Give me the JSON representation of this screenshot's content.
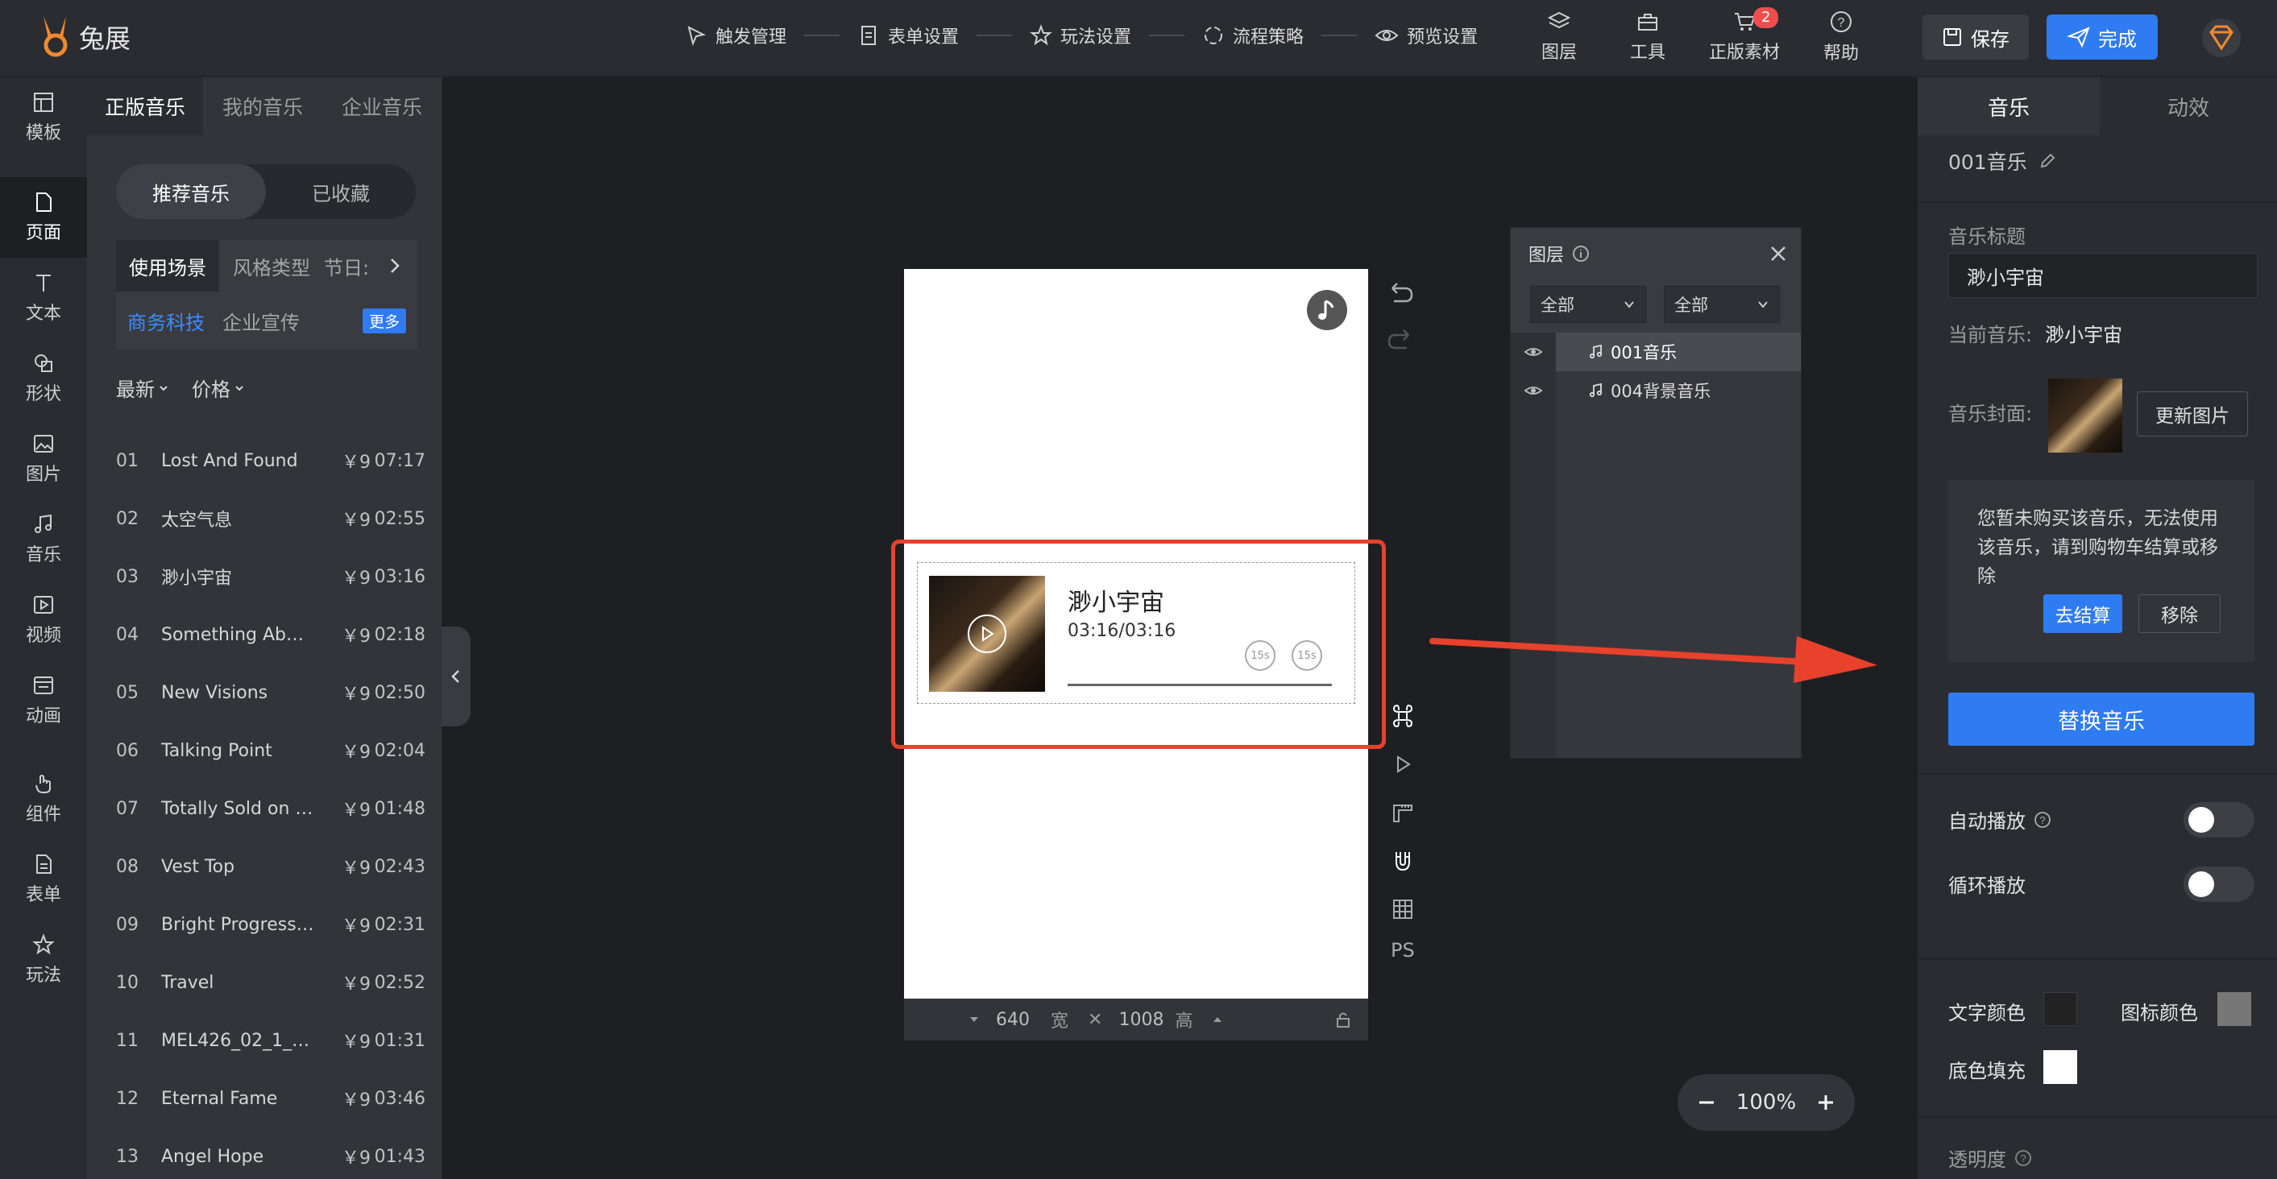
{
  "app": {
    "name": "兔展"
  },
  "toolbar": {
    "steps": [
      "触发管理",
      "表单设置",
      "玩法设置",
      "流程策略",
      "预览设置"
    ],
    "tools": [
      "图层",
      "工具",
      "正版素材",
      "帮助"
    ],
    "cart_badge": "2",
    "save_label": "保存",
    "done_label": "完成"
  },
  "sidebar": {
    "items": [
      "模板",
      "页面",
      "文本",
      "形状",
      "图片",
      "音乐",
      "视频",
      "动画",
      "组件",
      "表单",
      "玩法"
    ],
    "active": "页面"
  },
  "music_panel": {
    "tabs": [
      "正版音乐",
      "我的音乐",
      "企业音乐"
    ],
    "toggle": [
      "推荐音乐",
      "已收藏"
    ],
    "category_tabs": [
      "使用场景",
      "风格类型",
      "节日:"
    ],
    "tags": [
      "商务科技",
      "企业宣传"
    ],
    "more_label": "更多",
    "sorts": [
      "最新",
      "价格"
    ],
    "tracks": [
      {
        "num": "01",
        "name": "Lost And Found",
        "price": "￥9",
        "duration": "07:17"
      },
      {
        "num": "02",
        "name": "太空气息",
        "price": "￥9",
        "duration": "02:55"
      },
      {
        "num": "03",
        "name": "渺小宇宙",
        "price": "￥9",
        "duration": "03:16"
      },
      {
        "num": "04",
        "name": "Something Abo…",
        "price": "￥9",
        "duration": "02:18"
      },
      {
        "num": "05",
        "name": "New Visions",
        "price": "￥9",
        "duration": "02:50"
      },
      {
        "num": "06",
        "name": "Talking Point",
        "price": "￥9",
        "duration": "02:04"
      },
      {
        "num": "07",
        "name": "Totally Sold on …",
        "price": "￥9",
        "duration": "01:48"
      },
      {
        "num": "08",
        "name": "Vest Top",
        "price": "￥9",
        "duration": "02:43"
      },
      {
        "num": "09",
        "name": "Bright Progress…",
        "price": "￥9",
        "duration": "02:31"
      },
      {
        "num": "10",
        "name": "Travel",
        "price": "￥9",
        "duration": "02:52"
      },
      {
        "num": "11",
        "name": "MEL426_02_1_…",
        "price": "￥9",
        "duration": "01:31"
      },
      {
        "num": "12",
        "name": "Eternal Fame",
        "price": "￥9",
        "duration": "03:46"
      },
      {
        "num": "13",
        "name": "Angel Hope",
        "price": "￥9",
        "duration": "01:43"
      }
    ]
  },
  "canvas": {
    "player_title": "渺小宇宙",
    "player_time": "03:16/03:16",
    "skip_back": "15s",
    "skip_forward": "15s",
    "width": "640",
    "width_label": "宽",
    "height": "1008",
    "height_label": "高",
    "ps_label": "PS",
    "zoom": "100%"
  },
  "layers_panel": {
    "title": "图层",
    "filter1": "全部",
    "filter2": "全部",
    "items": [
      "001音乐",
      "004背景音乐"
    ]
  },
  "right_panel": {
    "tabs": [
      "音乐",
      "动效"
    ],
    "component_name": "001音乐",
    "title_label": "音乐标题",
    "title_value": "渺小宇宙",
    "current_label": "当前音乐:",
    "current_value": "渺小宇宙",
    "cover_label": "音乐封面:",
    "update_cover": "更新图片",
    "notice": "您暂未购买该音乐，无法使用该音乐，请到购物车结算或移除",
    "checkout_btn": "去结算",
    "remove_btn": "移除",
    "replace_btn": "替换音乐",
    "autoplay_label": "自动播放",
    "loop_label": "循环播放",
    "text_color_label": "文字颜色",
    "icon_color_label": "图标颜色",
    "bg_fill_label": "底色填充",
    "opacity_label": "透明度"
  },
  "colors": {
    "accent": "#2f7bf2",
    "highlight_red": "#e8412c",
    "brand_orange": "#f0892e"
  }
}
